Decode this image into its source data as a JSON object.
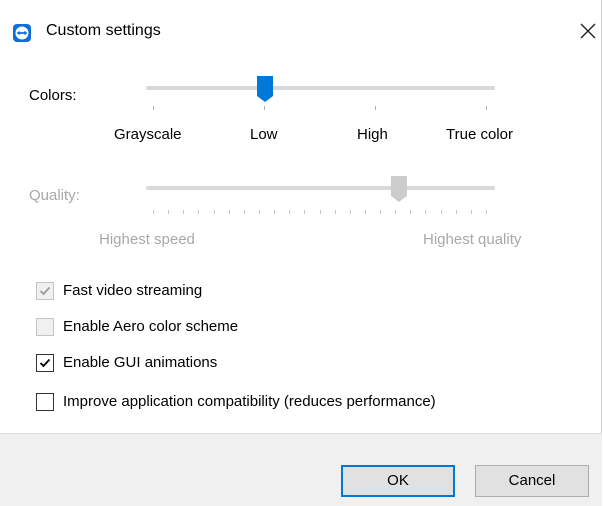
{
  "window": {
    "title": "Custom settings",
    "app_icon": "teamviewer-icon",
    "close_icon": "close-icon"
  },
  "colors": {
    "label": "Colors:",
    "options": [
      "Grayscale",
      "Low",
      "High",
      "True color"
    ],
    "selected": "Low",
    "accent": "#0078d7"
  },
  "quality": {
    "label": "Quality:",
    "min_label": "Highest speed",
    "max_label": "Highest quality",
    "level_fraction": 0.75,
    "tick_count": 23,
    "enabled": false
  },
  "options": [
    {
      "label": "Fast video streaming",
      "checked": true,
      "enabled": false
    },
    {
      "label": "Enable Aero color scheme",
      "checked": false,
      "enabled": false
    },
    {
      "label": "Enable GUI animations",
      "checked": true,
      "enabled": true
    },
    {
      "label": "Improve application compatibility (reduces performance)",
      "checked": false,
      "enabled": true
    }
  ],
  "buttons": {
    "ok": "OK",
    "cancel": "Cancel"
  }
}
